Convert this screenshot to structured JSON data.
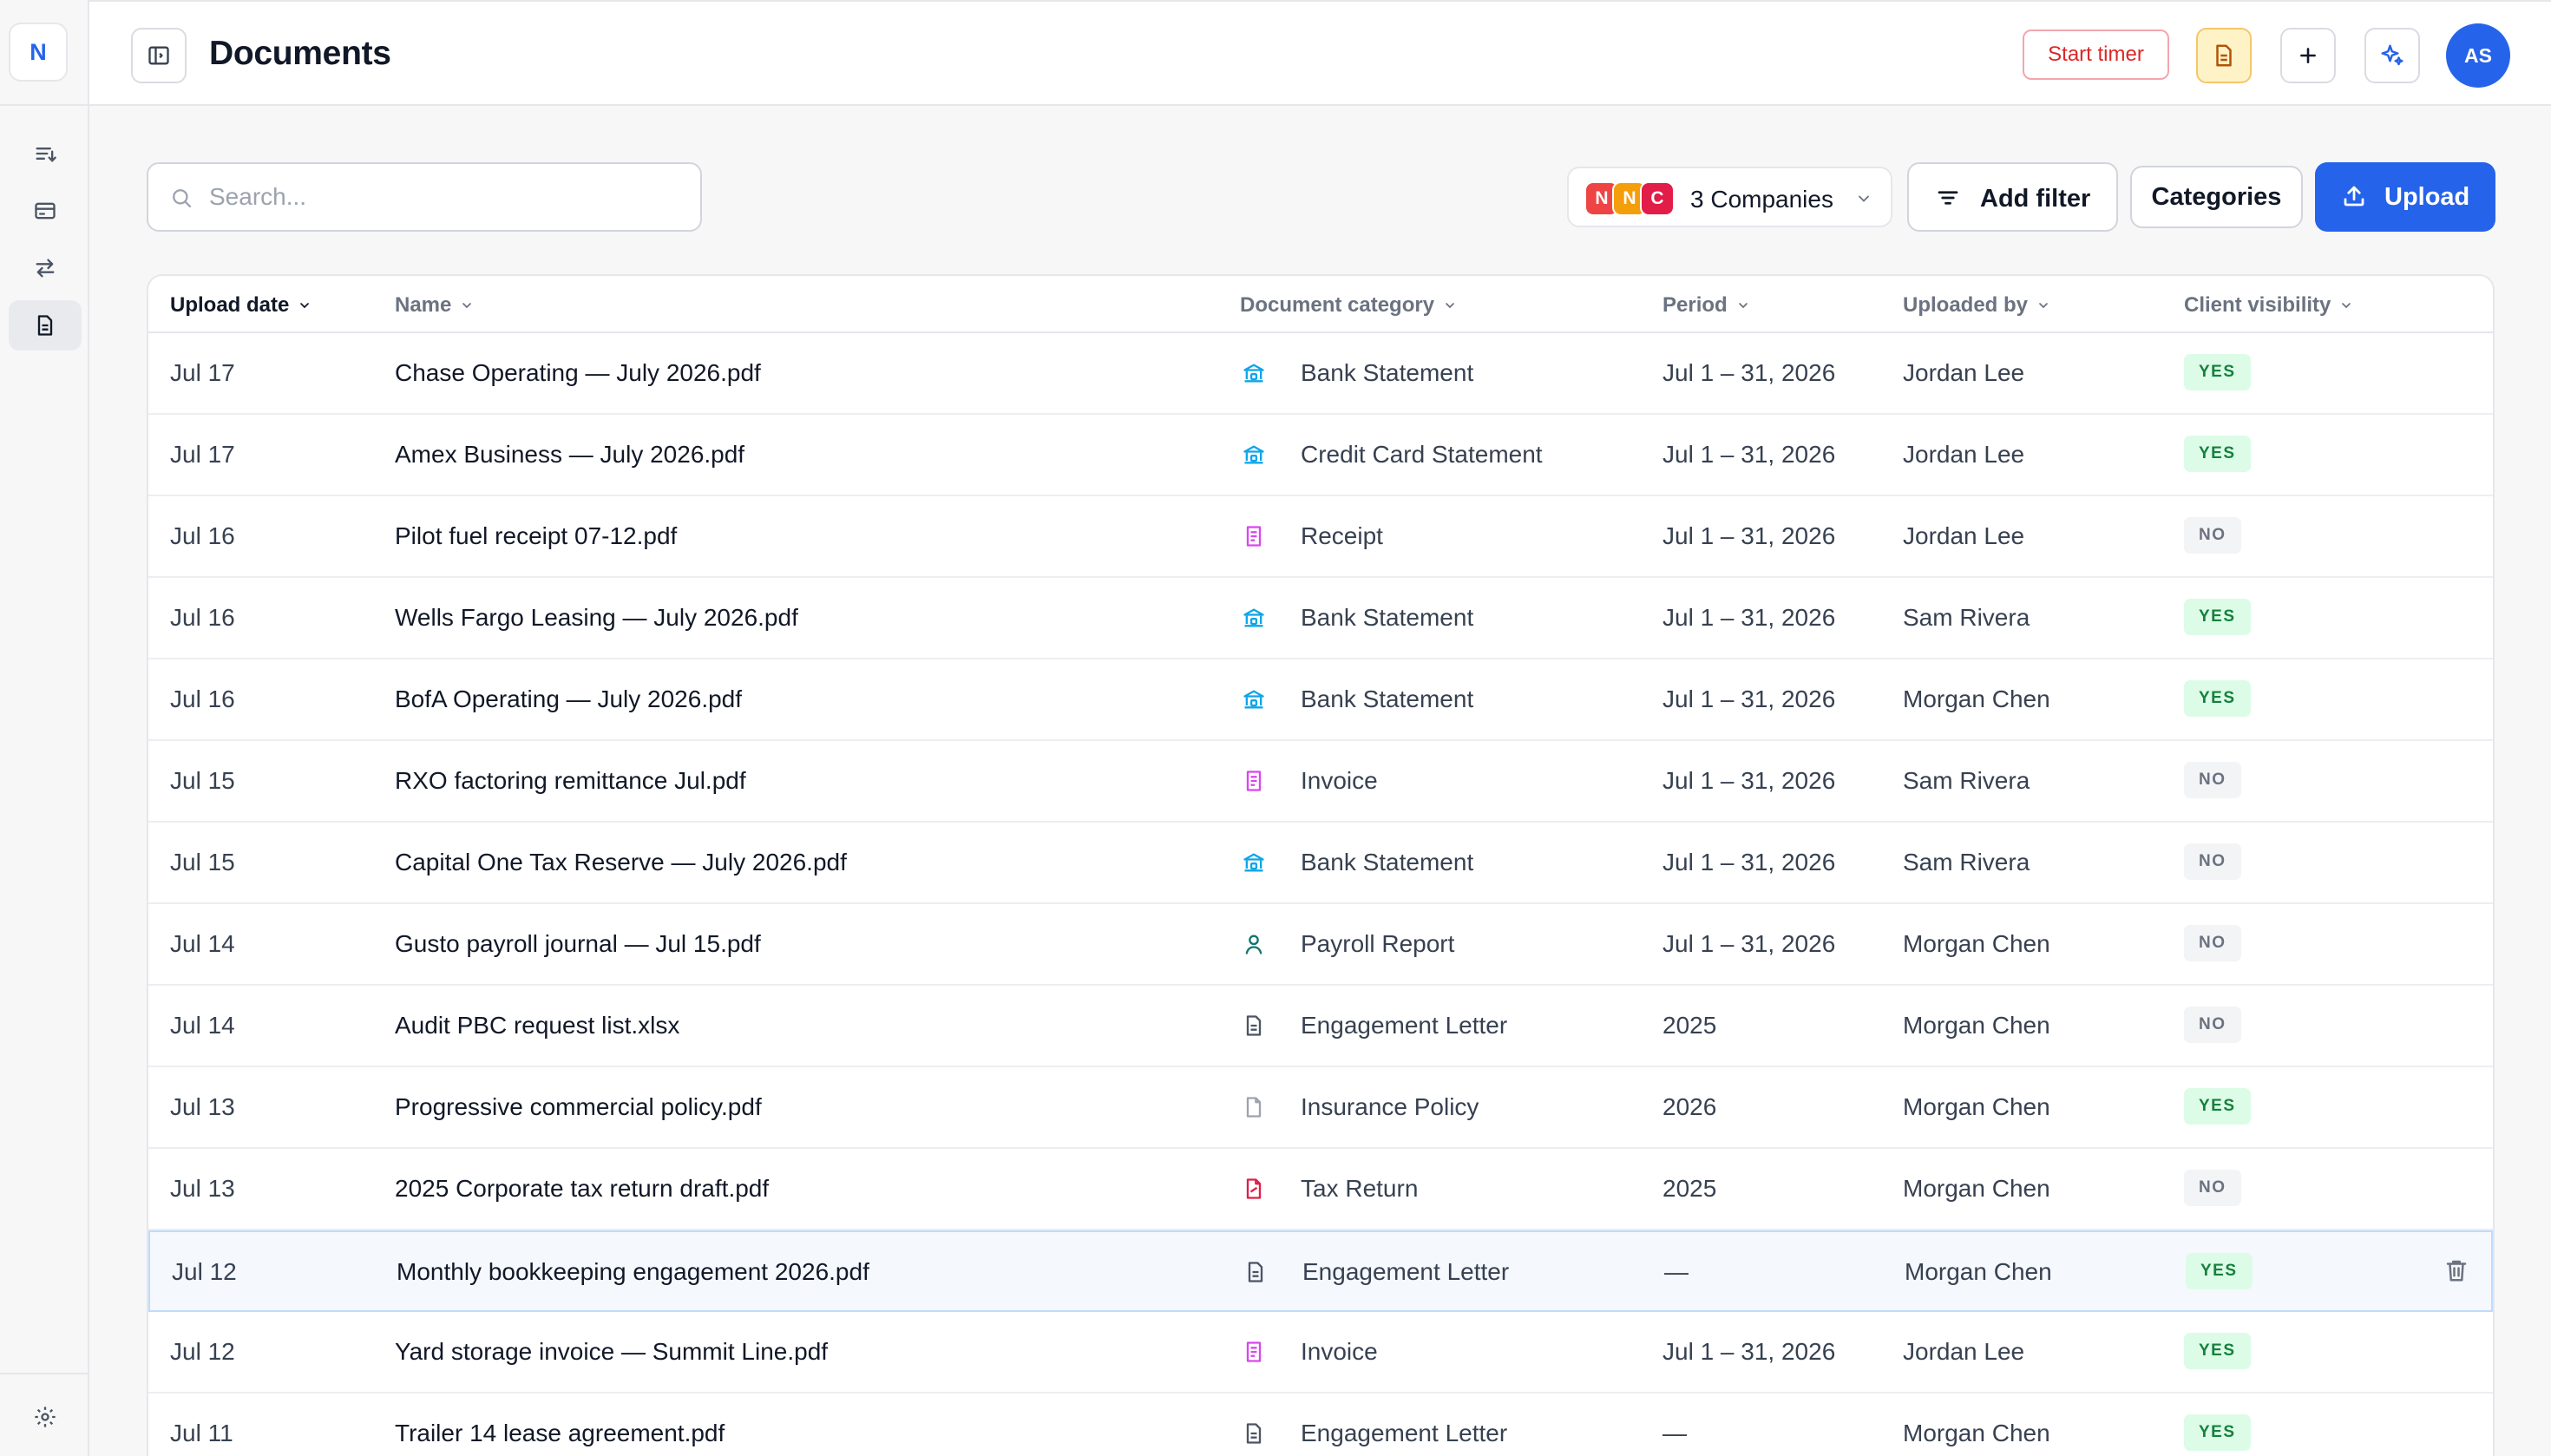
{
  "rail": {
    "logo_letter": "N",
    "items": [
      {
        "icon": "list-filter-icon",
        "active": false
      },
      {
        "icon": "credit-card-icon",
        "active": false
      },
      {
        "icon": "transfer-arrows-icon",
        "active": false
      },
      {
        "icon": "document-icon",
        "active": true
      }
    ],
    "bottom_icon": "settings-gear-icon"
  },
  "header": {
    "title": "Documents",
    "start_timer_label": "Start timer",
    "avatar_initials": "AS"
  },
  "toolbar": {
    "search_placeholder": "Search...",
    "search_value": "",
    "companies": {
      "label": "3 Companies",
      "chips": [
        {
          "letter": "N",
          "color": "#ef4444"
        },
        {
          "letter": "N",
          "color": "#f59e0b"
        },
        {
          "letter": "C",
          "color": "#e11d48"
        }
      ]
    },
    "add_filter_label": "Add filter",
    "categories_label": "Categories",
    "upload_label": "Upload"
  },
  "colors": {
    "accent": "#2563eb",
    "danger": "#dc2626",
    "yes_bg": "#dcfce7",
    "yes_text": "#15803d",
    "no_bg": "#f3f4f6",
    "no_text": "#6b7280"
  },
  "table": {
    "columns": [
      {
        "key": "upload_date",
        "label": "Upload date"
      },
      {
        "key": "name",
        "label": "Name"
      },
      {
        "key": "category",
        "label": "Document category"
      },
      {
        "key": "period",
        "label": "Period"
      },
      {
        "key": "uploaded_by",
        "label": "Uploaded by"
      },
      {
        "key": "visibility",
        "label": "Client visibility"
      }
    ],
    "rows": [
      {
        "date": "Jul 17",
        "name": "Chase Operating — July 2026.pdf",
        "category": "Bank Statement",
        "cat_icon": "bank-icon",
        "period": "Jul 1 – 31, 2026",
        "by": "Jordan Lee",
        "visibility": "YES"
      },
      {
        "date": "Jul 17",
        "name": "Amex Business — July 2026.pdf",
        "category": "Credit Card Statement",
        "cat_icon": "bank-icon",
        "period": "Jul 1 – 31, 2026",
        "by": "Jordan Lee",
        "visibility": "YES"
      },
      {
        "date": "Jul 16",
        "name": "Pilot fuel receipt 07-12.pdf",
        "category": "Receipt",
        "cat_icon": "receipt-icon",
        "period": "Jul 1 – 31, 2026",
        "by": "Jordan Lee",
        "visibility": "NO"
      },
      {
        "date": "Jul 16",
        "name": "Wells Fargo Leasing — July 2026.pdf",
        "category": "Bank Statement",
        "cat_icon": "bank-icon",
        "period": "Jul 1 – 31, 2026",
        "by": "Sam Rivera",
        "visibility": "YES"
      },
      {
        "date": "Jul 16",
        "name": "BofA Operating — July 2026.pdf",
        "category": "Bank Statement",
        "cat_icon": "bank-icon",
        "period": "Jul 1 – 31, 2026",
        "by": "Morgan Chen",
        "visibility": "YES"
      },
      {
        "date": "Jul 15",
        "name": "RXO factoring remittance Jul.pdf",
        "category": "Invoice",
        "cat_icon": "receipt-icon",
        "period": "Jul 1 – 31, 2026",
        "by": "Sam Rivera",
        "visibility": "NO"
      },
      {
        "date": "Jul 15",
        "name": "Capital One Tax Reserve — July 2026.pdf",
        "category": "Bank Statement",
        "cat_icon": "bank-icon",
        "period": "Jul 1 – 31, 2026",
        "by": "Sam Rivera",
        "visibility": "NO"
      },
      {
        "date": "Jul 14",
        "name": "Gusto payroll journal — Jul 15.pdf",
        "category": "Payroll Report",
        "cat_icon": "person-icon",
        "period": "Jul 1 – 31, 2026",
        "by": "Morgan Chen",
        "visibility": "NO"
      },
      {
        "date": "Jul 14",
        "name": "Audit PBC request list.xlsx",
        "category": "Engagement Letter",
        "cat_icon": "file-text-icon",
        "period": "2025",
        "by": "Morgan Chen",
        "visibility": "NO"
      },
      {
        "date": "Jul 13",
        "name": "Progressive commercial policy.pdf",
        "category": "Insurance Policy",
        "cat_icon": "file-blank-icon",
        "period": "2026",
        "by": "Morgan Chen",
        "visibility": "YES"
      },
      {
        "date": "Jul 13",
        "name": "2025 Corporate tax return draft.pdf",
        "category": "Tax Return",
        "cat_icon": "tax-file-icon",
        "period": "2025",
        "by": "Morgan Chen",
        "visibility": "NO"
      },
      {
        "date": "Jul 12",
        "name": "Monthly bookkeeping engagement 2026.pdf",
        "category": "Engagement Letter",
        "cat_icon": "file-text-icon",
        "period": "—",
        "by": "Morgan Chen",
        "visibility": "YES",
        "highlighted": true
      },
      {
        "date": "Jul 12",
        "name": "Yard storage invoice — Summit Line.pdf",
        "category": "Invoice",
        "cat_icon": "receipt-icon",
        "period": "Jul 1 – 31, 2026",
        "by": "Jordan Lee",
        "visibility": "YES"
      },
      {
        "date": "Jul 11",
        "name": "Trailer 14 lease agreement.pdf",
        "category": "Engagement Letter",
        "cat_icon": "file-text-icon",
        "period": "—",
        "by": "Morgan Chen",
        "visibility": "YES"
      }
    ]
  }
}
